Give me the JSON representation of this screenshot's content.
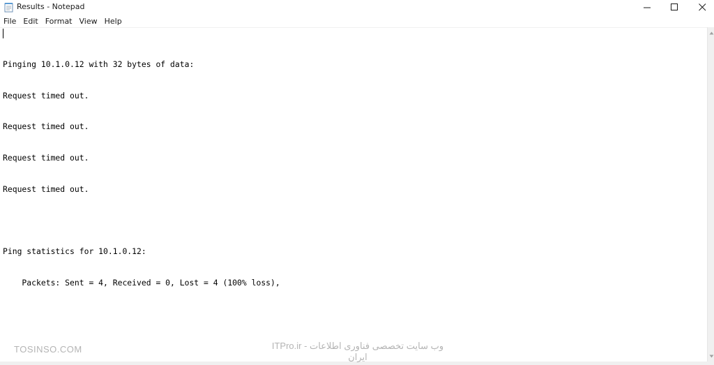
{
  "window": {
    "title": "Results - Notepad",
    "app_icon": "notepad-icon"
  },
  "titlebar_buttons": {
    "minimize_icon": "minimize-icon",
    "maximize_icon": "maximize-icon",
    "close_icon": "close-icon"
  },
  "menu": {
    "items": [
      "File",
      "Edit",
      "Format",
      "View",
      "Help"
    ]
  },
  "document": {
    "lines": [
      "",
      "Pinging 10.1.0.12 with 32 bytes of data:",
      "Request timed out.",
      "Request timed out.",
      "Request timed out.",
      "Request timed out.",
      "",
      "Ping statistics for 10.1.0.12:",
      "    Packets: Sent = 4, Received = 0, Lost = 4 (100% loss),"
    ]
  },
  "watermarks": {
    "left": "TOSINSO.COM",
    "center": "ITPro.ir - وب سایت تخصصی فناوری اطلاعات ایران"
  },
  "colors": {
    "text": "#000000",
    "watermark": "#b4b4b4",
    "scrollbar": "#f0f0f0"
  }
}
